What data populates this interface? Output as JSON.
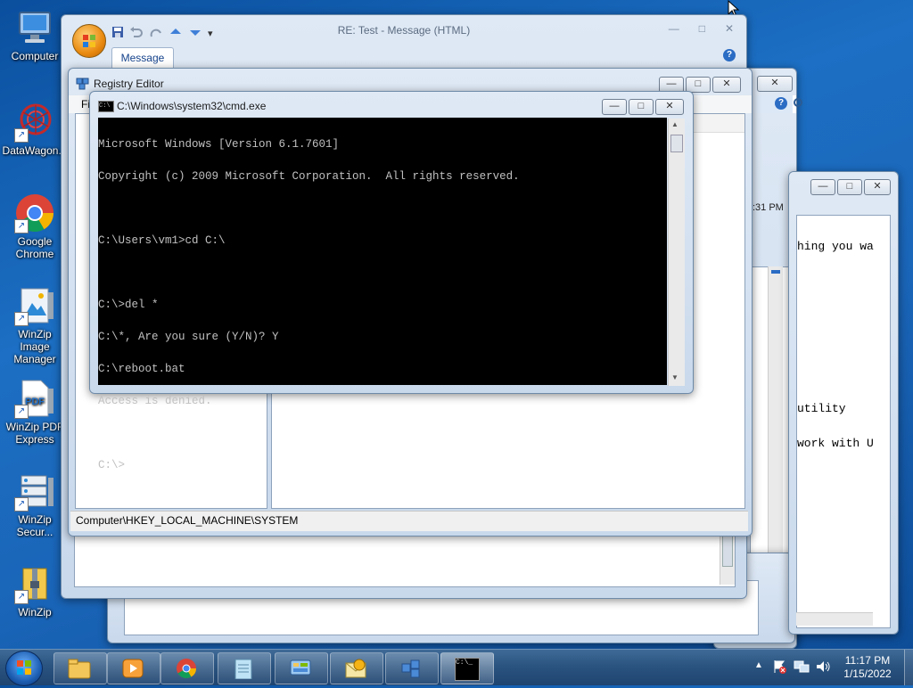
{
  "desktop": {
    "icons": [
      {
        "label": "Computer"
      },
      {
        "label": "DataWagon..."
      },
      {
        "label": "Google Chrome"
      },
      {
        "label": "WinZip Image Manager"
      },
      {
        "label": "WinZip PDF Express"
      },
      {
        "label": "WinZip Secur..."
      },
      {
        "label": "WinZip"
      }
    ]
  },
  "outlook": {
    "title": "RE: Test - Message (HTML)",
    "tab": "Message"
  },
  "bg_window": {
    "time_fragment": ":31 PM"
  },
  "notepad": {
    "lines": [
      "hing you wa",
      "",
      "",
      "",
      "",
      "",
      "",
      "utility",
      "work with U"
    ]
  },
  "regedit": {
    "title": "Registry Editor",
    "menu_fragment": "Fi",
    "status": "Computer\\HKEY_LOCAL_MACHINE\\SYSTEM"
  },
  "cmd": {
    "title": "C:\\Windows\\system32\\cmd.exe",
    "lines": [
      "Microsoft Windows [Version 6.1.7601]",
      "Copyright (c) 2009 Microsoft Corporation.  All rights reserved.",
      "",
      "C:\\Users\\vm1>cd C:\\",
      "",
      "C:\\>del *",
      "C:\\*, Are you sure (Y/N)? Y",
      "C:\\reboot.bat",
      "Access is denied.",
      "",
      "C:\\>"
    ]
  },
  "caption_buttons": {
    "minimize": "—",
    "maximize": "□",
    "close": "✕"
  },
  "help_glyph": "?",
  "taskbar": {
    "cmd_icon_text": "C:\\_",
    "clock_time": "11:17 PM",
    "clock_date": "1/15/2022"
  }
}
